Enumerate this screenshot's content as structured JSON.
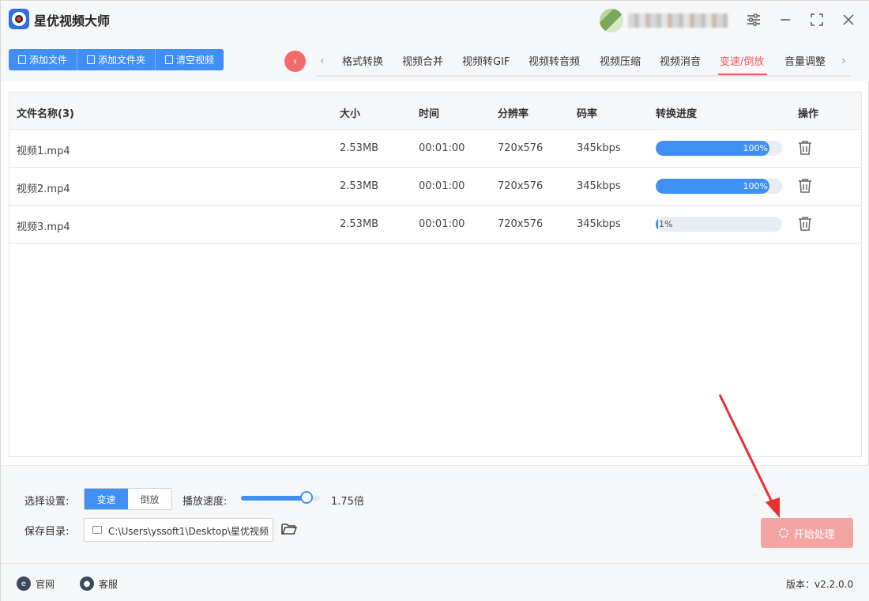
{
  "app": {
    "title": "星优视频大师"
  },
  "toolbar": {
    "add_file": "添加文件",
    "add_folder": "添加文件夹",
    "clear_videos": "清空视频"
  },
  "tabs": [
    {
      "label": "格式转换"
    },
    {
      "label": "视频合并"
    },
    {
      "label": "视频转GIF"
    },
    {
      "label": "视频转音频"
    },
    {
      "label": "视频压缩"
    },
    {
      "label": "视频消音"
    },
    {
      "label": "变速/倒放",
      "active": true
    },
    {
      "label": "音量调整"
    }
  ],
  "table": {
    "headers": [
      "文件名称(3)",
      "大小",
      "时间",
      "分辨率",
      "码率",
      "转换进度",
      "操作"
    ],
    "rows": [
      {
        "name": "视频1.mp4",
        "size": "2.53MB",
        "time": "00:01:00",
        "resolution": "720x576",
        "bitrate": "345kbps",
        "progress": 100,
        "progress_label": "100%"
      },
      {
        "name": "视频2.mp4",
        "size": "2.53MB",
        "time": "00:01:00",
        "resolution": "720x576",
        "bitrate": "345kbps",
        "progress": 100,
        "progress_label": "100%"
      },
      {
        "name": "视频3.mp4",
        "size": "2.53MB",
        "time": "00:01:00",
        "resolution": "720x576",
        "bitrate": "345kbps",
        "progress": 1,
        "progress_label": "1%"
      }
    ]
  },
  "settings": {
    "select_label": "选择设置:",
    "mode_speed": "变速",
    "mode_reverse": "倒放",
    "speed_label": "播放速度:",
    "speed_value": "1.75倍",
    "speed_fraction": 0.83,
    "save_dir_label": "保存目录:",
    "save_dir_path": "C:\\Users\\yssoft1\\Desktop\\星优视频",
    "start_button": "开始处理"
  },
  "status": {
    "website": "官网",
    "support": "客服",
    "version": "版本：v2.2.0.0"
  },
  "colors": {
    "accent": "#3f8ff5",
    "active_tab": "#f15a5a",
    "start_button": "#f5a4a4"
  }
}
